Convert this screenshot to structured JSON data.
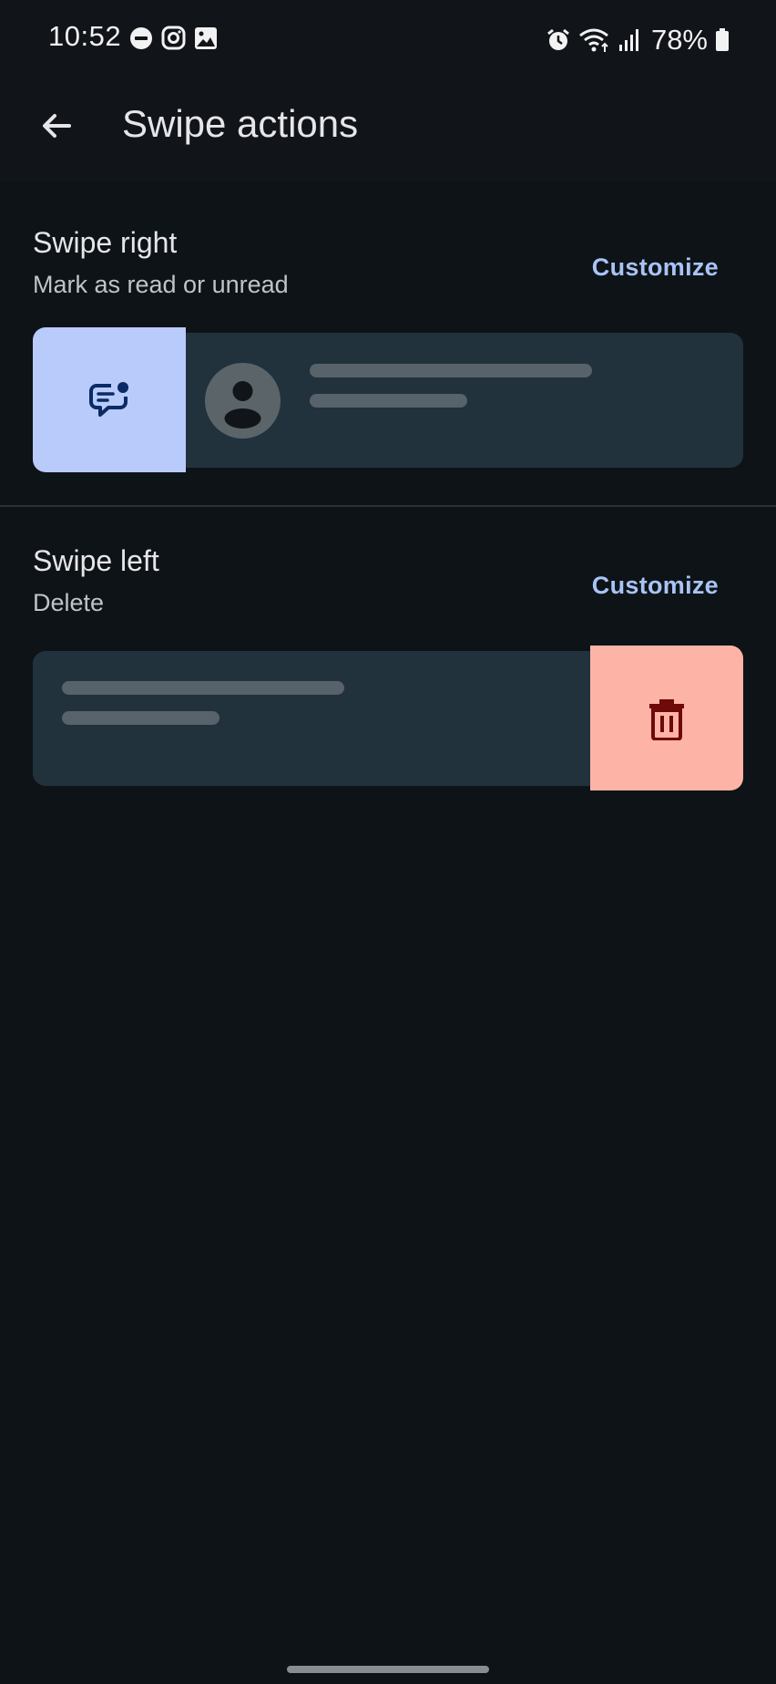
{
  "status_bar": {
    "time": "10:52",
    "battery": "78%",
    "left_icons": [
      "do-not-disturb-icon",
      "instagram-icon",
      "gallery-icon"
    ],
    "right_icons": [
      "alarm-icon",
      "wifi-icon",
      "signal-icon",
      "battery-icon"
    ]
  },
  "app_bar": {
    "back_icon": "back-arrow-icon",
    "title": "Swipe actions"
  },
  "swipe_right": {
    "title": "Swipe right",
    "action": "Mark as read or unread",
    "customize_label": "Customize",
    "action_icon": "mark-unread-icon",
    "action_color": "#b9cbfa"
  },
  "swipe_left": {
    "title": "Swipe left",
    "action": "Delete",
    "customize_label": "Customize",
    "action_icon": "delete-icon",
    "action_color": "#fdb4a6"
  },
  "colors": {
    "background": "#0e1317",
    "accent": "#a8c3f5",
    "preview_card": "#21323d"
  }
}
